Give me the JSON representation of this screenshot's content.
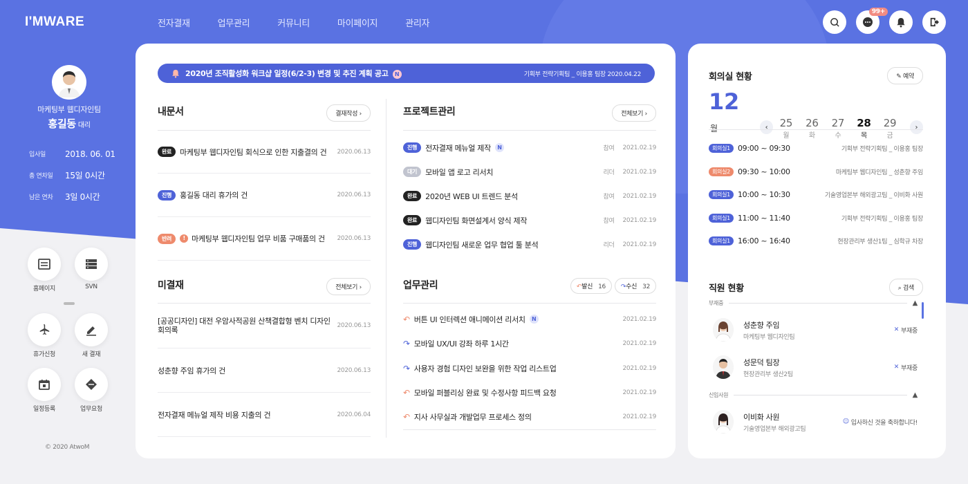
{
  "brand": {
    "logo": "I'MWARE",
    "primary_color": "#5a72e2",
    "accent_color": "#4e62d8",
    "alert_color": "#ee8a6c"
  },
  "nav": [
    "전자결재",
    "업무관리",
    "커뮤니티",
    "마이페이지",
    "관리자"
  ],
  "top_buttons": {
    "search": "search-icon",
    "chat": "chat-icon",
    "chat_badge": "99+",
    "bell": "bell-icon",
    "logout": "logout-icon"
  },
  "profile": {
    "team": "마케팅부 웹디자인팀",
    "name": "홍길동",
    "title": "대리",
    "info": [
      {
        "label": "입사일",
        "value": "2018. 06. 01"
      },
      {
        "label": "총 연차일",
        "value": "15일 0시간"
      },
      {
        "label": "남은 연차",
        "value": "3일 0시간"
      }
    ]
  },
  "quick_links": [
    {
      "label": "홈페이지",
      "icon": "homepage-icon"
    },
    {
      "label": "SVN",
      "icon": "server-icon"
    },
    {
      "label": "휴가신청",
      "icon": "airplane-icon"
    },
    {
      "label": "새 결재",
      "icon": "pen-icon"
    },
    {
      "label": "일정등록",
      "icon": "calendar-icon"
    },
    {
      "label": "업무요청",
      "icon": "request-icon"
    }
  ],
  "copyright": "© 2020 AtwoM",
  "notice": {
    "title": "2020년 조직활성화 워크샵 일정(6/2-3) 변경 및 추진 계획 공고",
    "badge": "N",
    "meta": "기획부 전략기획팀 _ 이용홍 팀장  2020.04.22"
  },
  "my_docs": {
    "title": "내문서",
    "button": "결재작성",
    "items": [
      {
        "tag": "완료",
        "text": "마케팅부 웹디자인팀 회식으로 인한 지출결의 건",
        "date": "2020.06.13"
      },
      {
        "tag": "진행",
        "text": "홍길동 대리 휴가의 건",
        "date": "2020.06.13"
      },
      {
        "tag": "반려",
        "text": "마케팅부 웹디자인팀 업무 비품 구매품의 건",
        "date": "2020.06.13"
      }
    ]
  },
  "pending": {
    "title": "미결재",
    "button": "전체보기",
    "items": [
      {
        "text": "[공공디자인] 대전 우암사적공원 산책결합형 벤치 디자인 회의록",
        "date": "2020.06.13"
      },
      {
        "text": "성춘향 주임 휴가의 건",
        "date": "2020.06.13"
      },
      {
        "text": "전자결재 메뉴얼 제작 비용 지출의 건",
        "date": "2020.06.04"
      }
    ]
  },
  "projects": {
    "title": "프로젝트관리",
    "button": "전체보기",
    "items": [
      {
        "tag": "진행",
        "text": "전자결재 메뉴얼 제작",
        "new": "N",
        "role": "참여",
        "date": "2021.02.19"
      },
      {
        "tag": "대기",
        "text": "모바일 앱 로고 리서치",
        "new": "",
        "role": "리더",
        "date": "2021.02.19"
      },
      {
        "tag": "완료",
        "text": "2020년 WEB UI 트렌드 분석",
        "new": "",
        "role": "참여",
        "date": "2021.02.19"
      },
      {
        "tag": "완료",
        "text": "웹디자인팀 화면설계서 양식 제작",
        "new": "",
        "role": "참여",
        "date": "2021.02.19"
      },
      {
        "tag": "진행",
        "text": "웹디자인팀 새로운 업무 협업 툴 분석",
        "new": "",
        "role": "리더",
        "date": "2021.02.19"
      }
    ]
  },
  "tasks": {
    "title": "업무관리",
    "sent_label": "발신",
    "sent_count": "16",
    "recv_label": "수신",
    "recv_count": "32",
    "items": [
      {
        "dir": "in",
        "text": "버튼 UI 인터렉션 애니메이션 리서치",
        "new": "N",
        "date": "2021.02.19"
      },
      {
        "dir": "out",
        "text": "모바일 UX/UI 강좌 하루 1시간",
        "new": "",
        "date": "2021.02.19"
      },
      {
        "dir": "out",
        "text": "사용자 경험 디자인 보완을 위한 작업 리스트업",
        "new": "",
        "date": "2021.02.19"
      },
      {
        "dir": "in",
        "text": "모바일 퍼블리싱 완료 및 수정사항 피드백 요청",
        "new": "",
        "date": "2021.02.19"
      },
      {
        "dir": "in",
        "text": "지사 사무실과 개발업무 프로세스 정의",
        "new": "",
        "date": "2021.02.19"
      }
    ]
  },
  "meeting": {
    "title": "회의실 현황",
    "button": "예약",
    "month": "12",
    "month_unit": "월",
    "days": [
      {
        "n": "25",
        "w": "월"
      },
      {
        "n": "26",
        "w": "화"
      },
      {
        "n": "27",
        "w": "수"
      },
      {
        "n": "28",
        "w": "목",
        "selected": true
      },
      {
        "n": "29",
        "w": "금"
      }
    ],
    "items": [
      {
        "room": "회의실1",
        "time": "09:00 ~ 09:30",
        "who": "기획부 전략기획팀 _ 이용홍 팀장"
      },
      {
        "room": "회의실2",
        "time": "09:30 ~ 10:00",
        "who": "마케팅부 웹디자인팀 _ 성춘향 주임"
      },
      {
        "room": "회의실1",
        "time": "10:00 ~ 10:30",
        "who": "기술영업본부 해외광고팀 _ 이비화 사원"
      },
      {
        "room": "회의실1",
        "time": "11:00 ~ 11:40",
        "who": "기획부 전략기획팀 _ 이용홍 팀장"
      },
      {
        "room": "회의실1",
        "time": "16:00 ~ 16:40",
        "who": "현장관리부 생산1팀 _ 심학규 차장"
      }
    ]
  },
  "staff": {
    "title": "직원 현황",
    "button": "검색",
    "group_absent": "부재중",
    "group_new": "신입사원",
    "absent": [
      {
        "name": "성춘향 주임",
        "dept": "마케팅부 웹디자인팀",
        "status": "부재중"
      },
      {
        "name": "성문덕 팀장",
        "dept": "현장관리부 생산2팀",
        "status": "부재중"
      }
    ],
    "newbies": [
      {
        "name": "이비화 사원",
        "dept": "기술영업본부 해외광고팀",
        "status": "입사하신 것을 축하합니다!"
      }
    ]
  }
}
